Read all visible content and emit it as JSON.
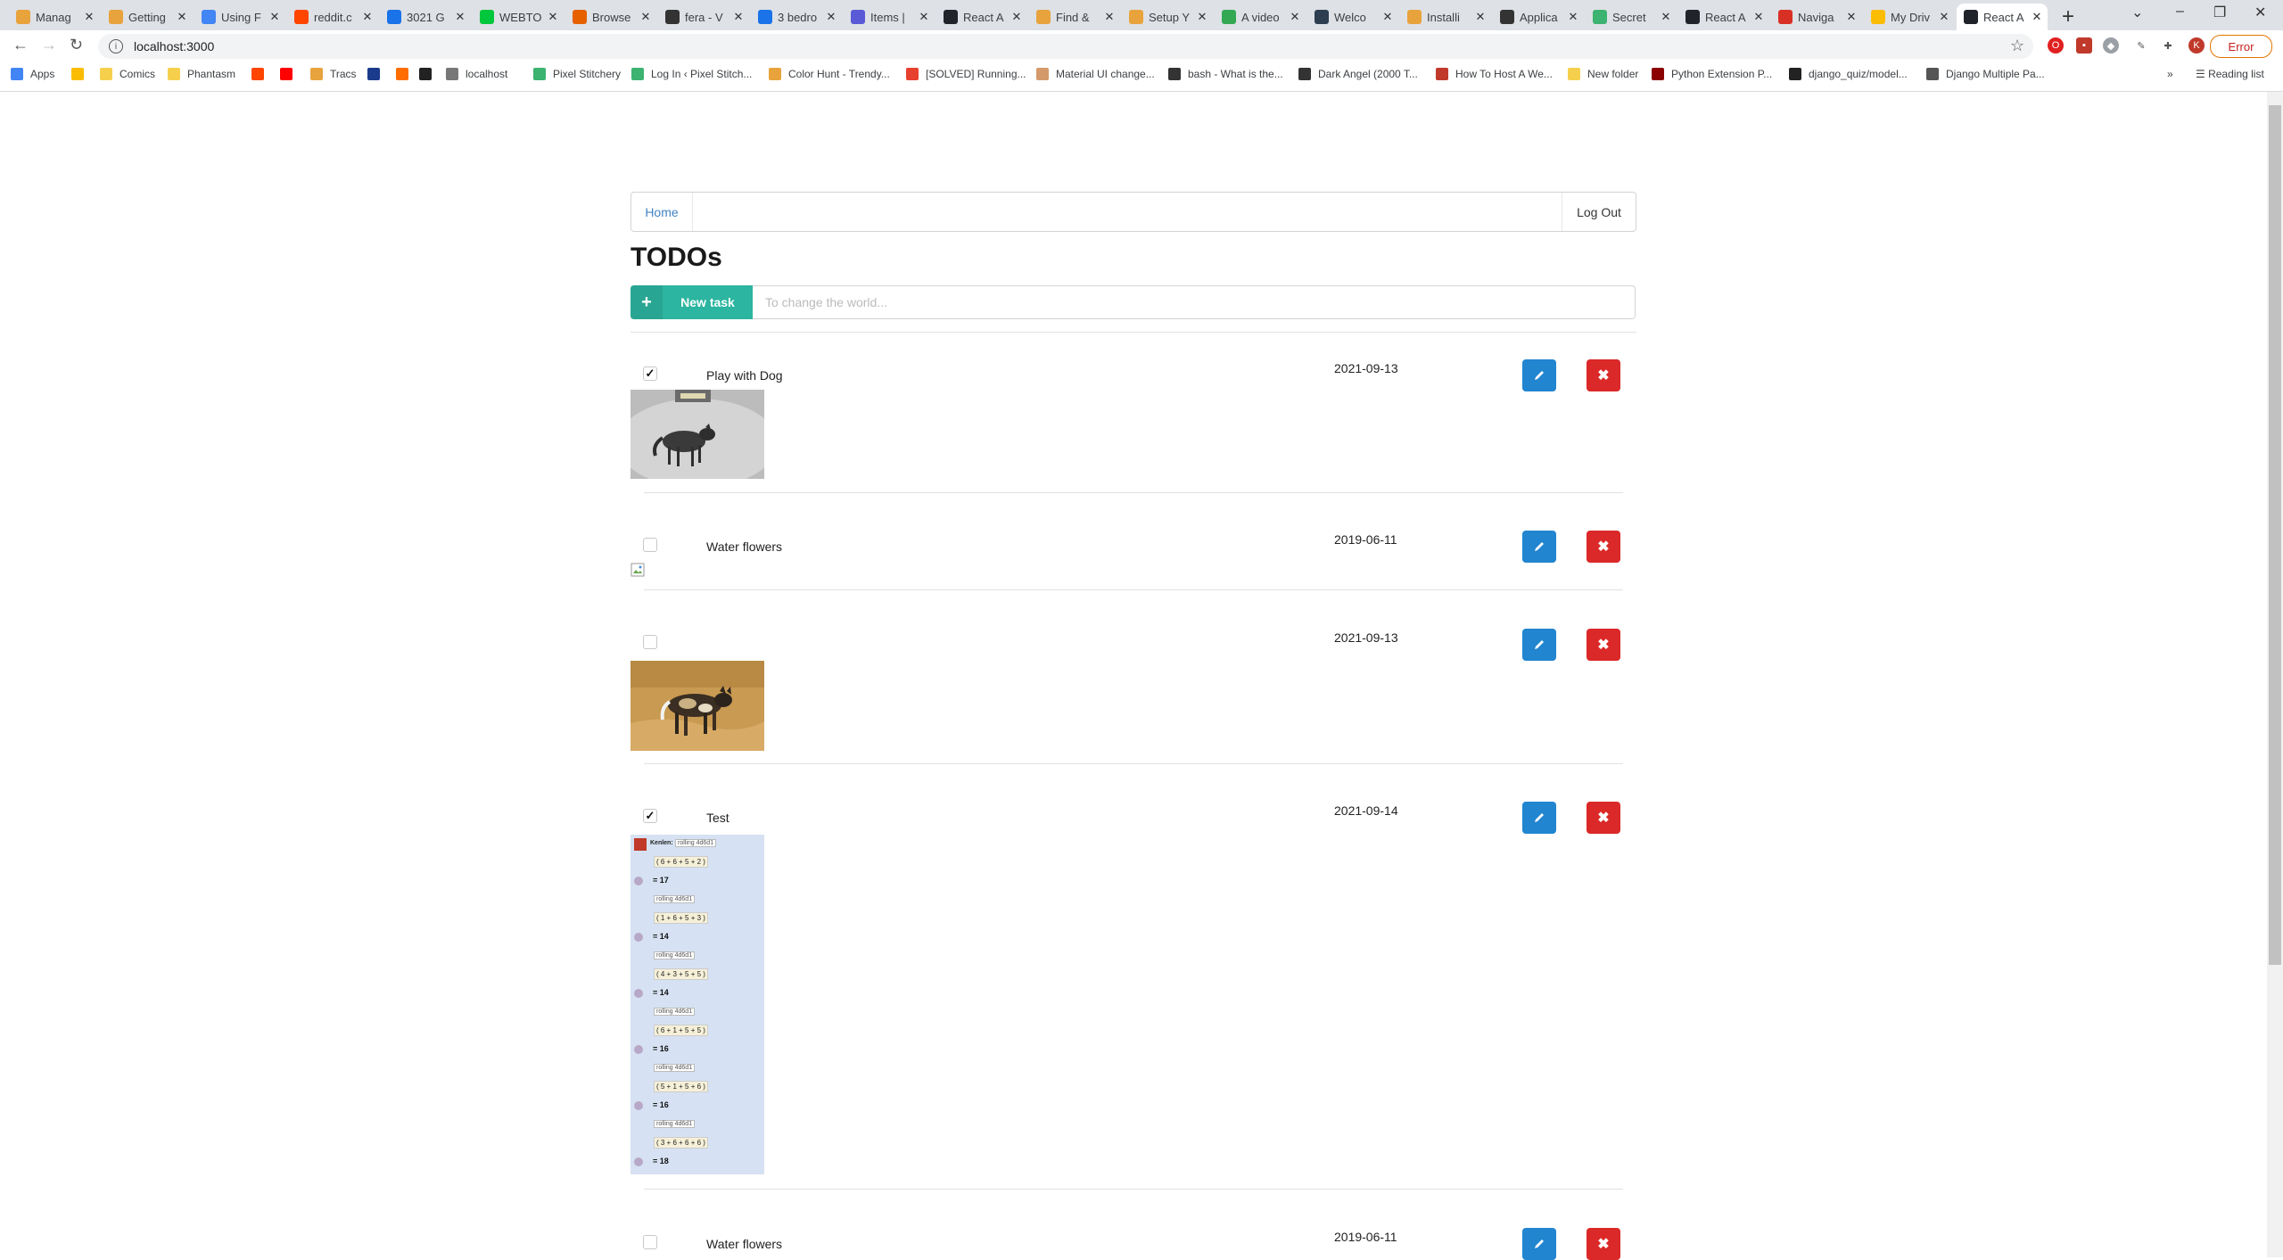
{
  "browser": {
    "tabs": [
      {
        "title": "Manag",
        "favicon": "#e8a33d"
      },
      {
        "title": "Getting",
        "favicon": "#e8a33d"
      },
      {
        "title": "Using F",
        "favicon": "#4285f4"
      },
      {
        "title": "reddit.c",
        "favicon": "#ff4500"
      },
      {
        "title": "3021 G",
        "favicon": "#1a73e8"
      },
      {
        "title": "WEBTO",
        "favicon": "#00c73c"
      },
      {
        "title": "Browse",
        "favicon": "#e66000"
      },
      {
        "title": "fera - V",
        "favicon": "#333333"
      },
      {
        "title": "3 bedro",
        "favicon": "#1a73e8"
      },
      {
        "title": "Items |",
        "favicon": "#5a5ad6"
      },
      {
        "title": "React A",
        "favicon": "#20232a"
      },
      {
        "title": "Find &",
        "favicon": "#e8a33d"
      },
      {
        "title": "Setup Y",
        "favicon": "#e8a33d"
      },
      {
        "title": "A video",
        "favicon": "#34a853"
      },
      {
        "title": "Welco",
        "favicon": "#2c3e50"
      },
      {
        "title": "Installi",
        "favicon": "#e8a33d"
      },
      {
        "title": "Applica",
        "favicon": "#333333"
      },
      {
        "title": "Secret",
        "favicon": "#3cb371"
      },
      {
        "title": "React A",
        "favicon": "#20232a"
      },
      {
        "title": "Naviga",
        "favicon": "#d93025"
      },
      {
        "title": "My Driv",
        "favicon": "#fbbc04"
      },
      {
        "title": "React A",
        "favicon": "#20232a"
      }
    ],
    "url": "localhost:3000",
    "error_label": "Error",
    "reading_list": "Reading list",
    "bookmarks": [
      {
        "label": "Apps"
      },
      {
        "label": ""
      },
      {
        "label": "Comics"
      },
      {
        "label": "Phantasm"
      },
      {
        "label": ""
      },
      {
        "label": ""
      },
      {
        "label": "Tracs"
      },
      {
        "label": ""
      },
      {
        "label": ""
      },
      {
        "label": ""
      },
      {
        "label": "localhost"
      },
      {
        "label": "Pixel Stitchery"
      },
      {
        "label": "Log In ‹ Pixel Stitch..."
      },
      {
        "label": "Color Hunt - Trendy..."
      },
      {
        "label": "[SOLVED] Running..."
      },
      {
        "label": "Material UI change..."
      },
      {
        "label": "bash - What is the..."
      },
      {
        "label": "Dark Angel (2000 T..."
      },
      {
        "label": "How To Host A We..."
      },
      {
        "label": "New folder"
      },
      {
        "label": "Python Extension P..."
      },
      {
        "label": "django_quiz/model..."
      },
      {
        "label": "Django Multiple Pa..."
      }
    ]
  },
  "nav": {
    "home": "Home",
    "logout": "Log Out"
  },
  "page": {
    "title": "TODOs",
    "new_task_label": "New task",
    "input_placeholder": "To change the world..."
  },
  "todos": [
    {
      "title": "Play with Dog",
      "date": "2021-09-13",
      "done": true,
      "image": "wolf-photo"
    },
    {
      "title": "Water flowers",
      "date": "2019-06-11",
      "done": false,
      "image": "broken-image"
    },
    {
      "title": "",
      "date": "2021-09-13",
      "done": false,
      "image": "wild-dog-photo"
    },
    {
      "title": "Test",
      "date": "2021-09-14",
      "done": true,
      "image": "dice-roll-screenshot"
    },
    {
      "title": "Water flowers",
      "date": "2019-06-11",
      "done": false,
      "image": ""
    }
  ],
  "dice": {
    "header_name": "Kenlen:",
    "roll_label": "rolling 4d6d1",
    "rolls": [
      {
        "dice": "( 6 + 6 + 5 + 2 )",
        "total": "= 17"
      },
      {
        "dice": "( 1 + 6 + 5 + 3 )",
        "total": "= 14"
      },
      {
        "dice": "( 4 + 3 + 5 + 5 )",
        "total": "= 14"
      },
      {
        "dice": "( 6 + 1 + 5 + 5 )",
        "total": "= 16"
      },
      {
        "dice": "( 5 + 1 + 5 + 6 )",
        "total": "= 16"
      },
      {
        "dice": "( 3 + 6 + 6 + 6 )",
        "total": "= 18"
      }
    ]
  }
}
